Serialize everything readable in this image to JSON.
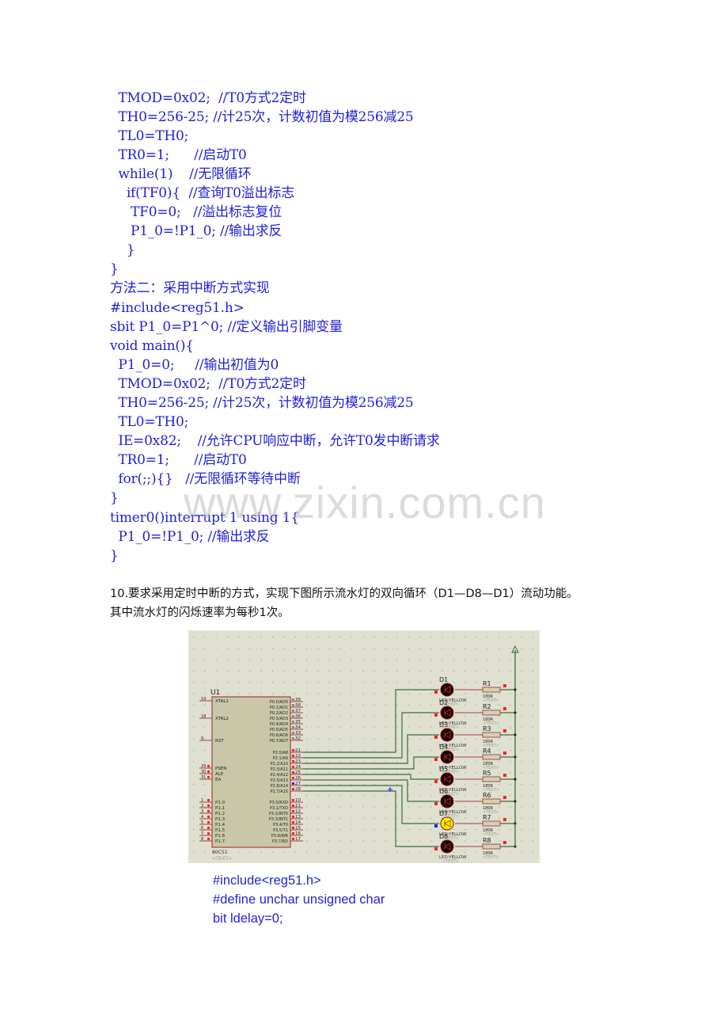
{
  "code_block_1": [
    "  TMOD=0x02;  //T0方式2定时",
    "  TH0=256-25; //计25次，计数初值为模256减25",
    "  TL0=TH0;",
    "  TR0=1;      //启动T0",
    "  while(1)    //无限循环",
    "    if(TF0){  //查询T0溢出标志",
    "     TF0=0;   //溢出标志复位",
    "     P1_0=!P1_0; //输出求反",
    "    }",
    "}"
  ],
  "method2_heading": "方法二：采用中断方式实现",
  "code_block_2": [
    "#include<reg51.h>",
    "sbit P1_0=P1^0; //定义输出引脚变量",
    "void main(){",
    "  P1_0=0;     //输出初值为0",
    "  TMOD=0x02;  //T0方式2定时",
    "  TH0=256-25; //计25次，计数初值为模256减25",
    "  TL0=TH0;",
    "  IE=0x82;    //允许CPU响应中断，允许T0发中断请求",
    "  TR0=1;      //启动T0",
    "  for(;;){}   //无限循环等待中断",
    "}",
    "timer0()interrupt 1 using 1{",
    "  P1_0=!P1_0; //输出求反",
    "}"
  ],
  "question": {
    "line1": "10.要求采用定时中断的方式，实现下图所示流水灯的双向循环（D1—D8—D1）流动功能。",
    "line2": "其中流水灯的闪烁速率为每秒1次。"
  },
  "schematic": {
    "chip_ref": "U1",
    "chip_part": "80C51",
    "chip_text": "<TEXT>",
    "left_pins": [
      {
        "num": "19",
        "name": "XTAL1"
      },
      {
        "num": "18",
        "name": "XTAL2"
      },
      {
        "num": "9",
        "name": "RST"
      },
      {
        "num": "29",
        "name": "PSEN"
      },
      {
        "num": "30",
        "name": "ALE"
      },
      {
        "num": "31",
        "name": "EA"
      },
      {
        "num": "1",
        "name": "P1.0"
      },
      {
        "num": "2",
        "name": "P1.1"
      },
      {
        "num": "3",
        "name": "P1.2"
      },
      {
        "num": "4",
        "name": "P1.3"
      },
      {
        "num": "5",
        "name": "P1.4"
      },
      {
        "num": "6",
        "name": "P1.5"
      },
      {
        "num": "7",
        "name": "P1.6"
      },
      {
        "num": "8",
        "name": "P1.7"
      }
    ],
    "right_pins_p0": [
      {
        "num": "39",
        "name": "P0.0/AD0"
      },
      {
        "num": "38",
        "name": "P0.1/AD1"
      },
      {
        "num": "37",
        "name": "P0.2/AD2"
      },
      {
        "num": "36",
        "name": "P0.3/AD3"
      },
      {
        "num": "35",
        "name": "P0.4/AD4"
      },
      {
        "num": "34",
        "name": "P0.5/AD5"
      },
      {
        "num": "33",
        "name": "P0.6/AD6"
      },
      {
        "num": "32",
        "name": "P0.7/AD7"
      }
    ],
    "right_pins_p2": [
      {
        "num": "21",
        "name": "P2.0/A8"
      },
      {
        "num": "22",
        "name": "P2.1/A9"
      },
      {
        "num": "23",
        "name": "P2.2/A10"
      },
      {
        "num": "24",
        "name": "P2.3/A11"
      },
      {
        "num": "25",
        "name": "P2.4/A12"
      },
      {
        "num": "26",
        "name": "P2.5/A13"
      },
      {
        "num": "27",
        "name": "P2.6/A14"
      },
      {
        "num": "28",
        "name": "P2.7/A15"
      }
    ],
    "right_pins_p3": [
      {
        "num": "10",
        "name": "P3.0/RXD"
      },
      {
        "num": "11",
        "name": "P3.1/TXD"
      },
      {
        "num": "12",
        "name": "P3.2/INT0"
      },
      {
        "num": "13",
        "name": "P3.3/INT1"
      },
      {
        "num": "14",
        "name": "P3.4/T0"
      },
      {
        "num": "15",
        "name": "P3.5/T1"
      },
      {
        "num": "16",
        "name": "P3.6/WR"
      },
      {
        "num": "17",
        "name": "P3.7/RD"
      }
    ],
    "leds": [
      {
        "ref": "D1",
        "part": "LED-YELLOW",
        "lit": false
      },
      {
        "ref": "D2",
        "part": "LED-YELLOW",
        "lit": false
      },
      {
        "ref": "D3",
        "part": "LED-YELLOW",
        "lit": false
      },
      {
        "ref": "D4",
        "part": "LED-YELLOW",
        "lit": false
      },
      {
        "ref": "D5",
        "part": "LED-YELLOW",
        "lit": false
      },
      {
        "ref": "D6",
        "part": "LED-YELLOW",
        "lit": false
      },
      {
        "ref": "D7",
        "part": "LED-YELLOW",
        "lit": true
      },
      {
        "ref": "D8",
        "part": "LED-YELLOW",
        "lit": false
      }
    ],
    "resistors": [
      {
        "ref": "R1",
        "value": "180R"
      },
      {
        "ref": "R2",
        "value": "180R"
      },
      {
        "ref": "R3",
        "value": "180R"
      },
      {
        "ref": "R4",
        "value": "180R"
      },
      {
        "ref": "R5",
        "value": "180R"
      },
      {
        "ref": "R6",
        "value": "180R"
      },
      {
        "ref": "R7",
        "value": "180R"
      },
      {
        "ref": "R8",
        "value": "180R"
      }
    ],
    "text_placeholder": "<TEXT>",
    "colors": {
      "background": "#e0e0d0",
      "chip_fill": "#c8c8a8",
      "chip_border": "#a04040",
      "wire": "#3a6b3a",
      "led_off": "#1a0000",
      "led_on": "#ffee00",
      "pin_active": "#ff2020",
      "pin_blue": "#2020ff"
    }
  },
  "code_block_3": [
    "#include<reg51.h>",
    "#define unchar unsigned char",
    "bit ldelay=0;"
  ],
  "watermark": "www.zixin.com.cn"
}
